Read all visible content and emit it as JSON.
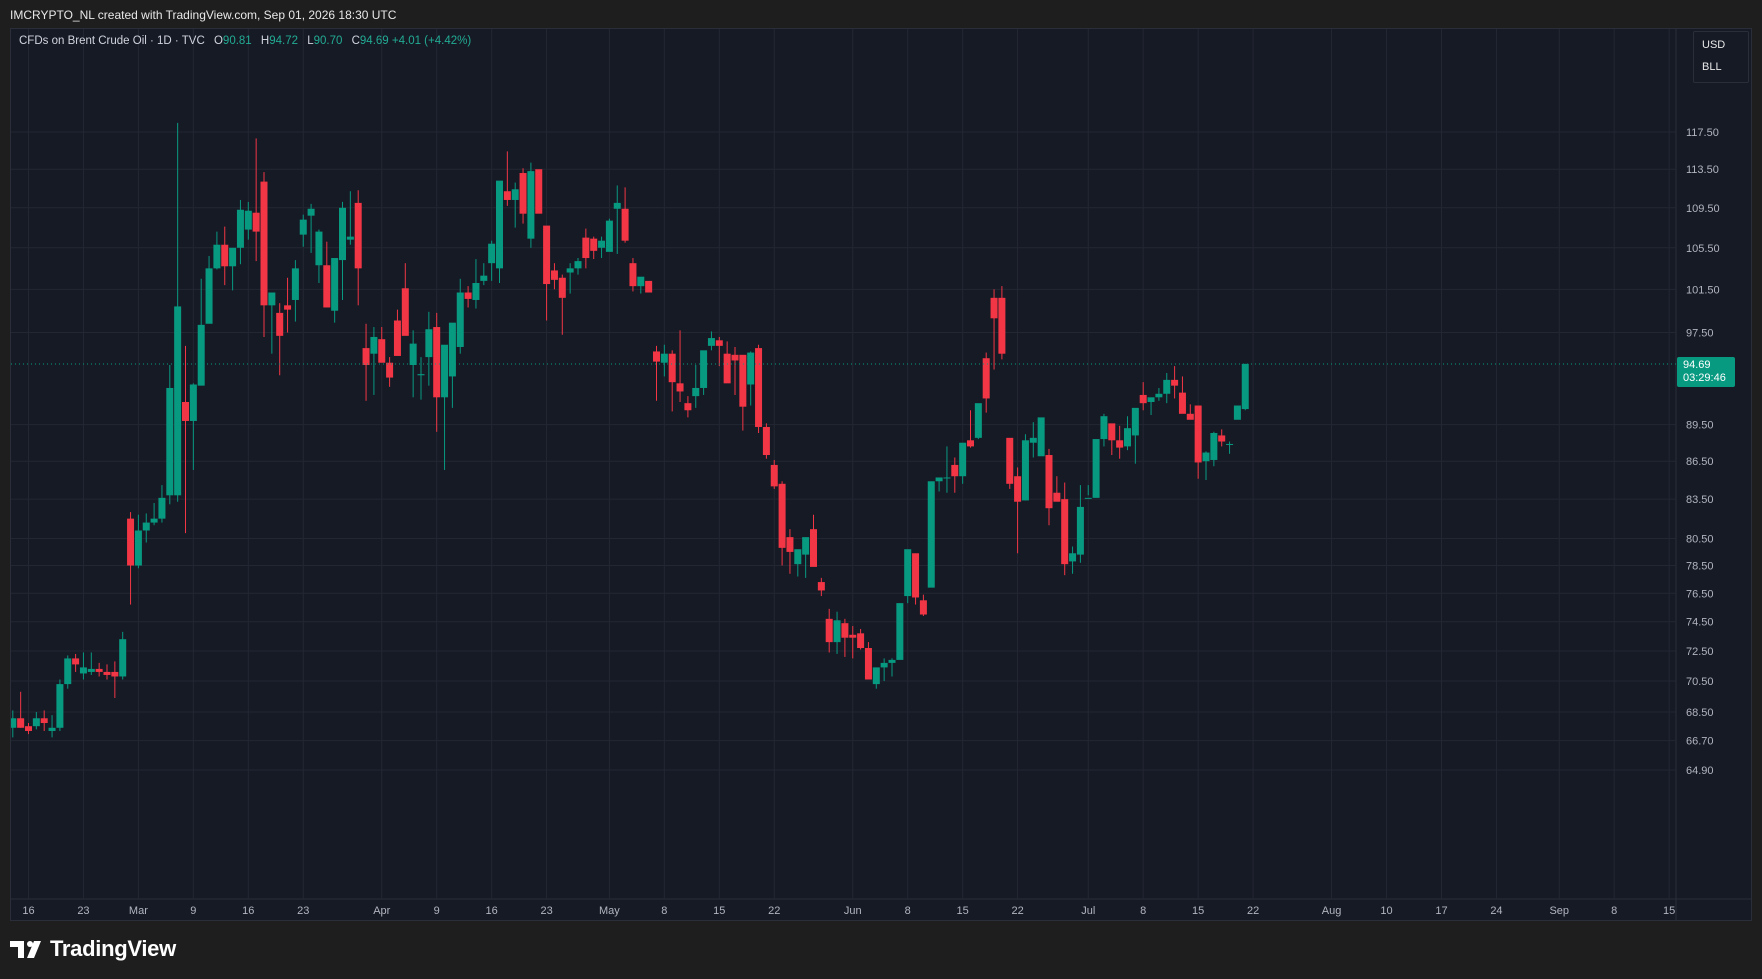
{
  "attribution": "IMCRYPTO_NL created with TradingView.com, Sep 01, 2026 18:30 UTC",
  "legend": {
    "symbol": "CFDs on Brent Crude Oil · 1D · TVC",
    "open_label": "O",
    "open_value": "90.81",
    "high_label": "H",
    "high_value": "94.72",
    "low_label": "L",
    "low_value": "90.70",
    "close_label": "C",
    "close_value": "94.69",
    "change": "+4.01 (+4.42%)"
  },
  "units": {
    "currency": "USD",
    "measure": "BLL"
  },
  "last_price": {
    "price": "94.69",
    "countdown": "03:29:46"
  },
  "brand": {
    "logo_text": "TradingView"
  },
  "colors": {
    "up": "#089981",
    "down": "#f23645",
    "background": "#161a25",
    "grid": "#232733"
  },
  "chart_data": {
    "type": "candlestick",
    "y_axis": {
      "ticks": [
        117.5,
        113.5,
        109.5,
        105.5,
        101.5,
        97.5,
        89.5,
        86.5,
        83.5,
        80.5,
        78.5,
        76.5,
        74.5,
        72.5,
        70.5,
        68.5,
        66.7,
        64.9
      ],
      "tick_labels": [
        "117.50",
        "113.50",
        "109.50",
        "105.50",
        "101.50",
        "97.50",
        "89.50",
        "86.50",
        "83.50",
        "80.50",
        "78.50",
        "76.50",
        "74.50",
        "72.50",
        "70.50",
        "68.50",
        "66.70",
        "64.90"
      ],
      "scale": "log"
    },
    "x_axis": {
      "tick_labels": [
        {
          "label": "16",
          "day": 0
        },
        {
          "label": "23",
          "day": 7
        },
        {
          "label": "Mar",
          "day": 14
        },
        {
          "label": "9",
          "day": 21
        },
        {
          "label": "16",
          "day": 28
        },
        {
          "label": "23",
          "day": 35
        },
        {
          "label": "Apr",
          "day": 45
        },
        {
          "label": "9",
          "day": 52
        },
        {
          "label": "16",
          "day": 59
        },
        {
          "label": "23",
          "day": 66
        },
        {
          "label": "May",
          "day": 74
        },
        {
          "label": "8",
          "day": 81
        },
        {
          "label": "15",
          "day": 88
        },
        {
          "label": "22",
          "day": 95
        },
        {
          "label": "Jun",
          "day": 105
        },
        {
          "label": "8",
          "day": 112
        },
        {
          "label": "15",
          "day": 119
        },
        {
          "label": "22",
          "day": 126
        },
        {
          "label": "Jul",
          "day": 135
        },
        {
          "label": "8",
          "day": 142
        },
        {
          "label": "15",
          "day": 149
        },
        {
          "label": "22",
          "day": 156
        },
        {
          "label": "Aug",
          "day": 166
        },
        {
          "label": "10",
          "day": 173
        },
        {
          "label": "17",
          "day": 180
        },
        {
          "label": "24",
          "day": 187
        },
        {
          "label": "Sep",
          "day": 195
        },
        {
          "label": "8",
          "day": 202
        },
        {
          "label": "15",
          "day": 209
        }
      ]
    },
    "candles": [
      [
        -2,
        67.5,
        68.6,
        66.9,
        68.1
      ],
      [
        -1,
        68.1,
        69.8,
        67.5,
        67.5
      ],
      [
        0,
        67.6,
        67.8,
        67.1,
        67.3
      ],
      [
        1,
        67.6,
        68.5,
        67.4,
        68.1
      ],
      [
        2,
        68.1,
        68.6,
        67.3,
        67.8
      ],
      [
        3,
        67.3,
        68.3,
        66.9,
        67.5
      ],
      [
        4,
        67.5,
        70.6,
        67.3,
        70.3
      ],
      [
        5,
        70.3,
        72.2,
        70.0,
        72.0
      ],
      [
        6,
        72.0,
        72.3,
        71.1,
        71.6
      ],
      [
        7,
        71.0,
        72.4,
        70.6,
        71.4
      ],
      [
        8,
        71.1,
        72.4,
        70.9,
        71.3
      ],
      [
        9,
        71.3,
        71.7,
        70.8,
        71.1
      ],
      [
        10,
        71.1,
        71.6,
        70.6,
        70.9
      ],
      [
        11,
        71.1,
        71.8,
        69.4,
        70.8
      ],
      [
        12,
        70.8,
        73.8,
        70.6,
        73.3
      ],
      [
        13,
        82.0,
        82.5,
        75.7,
        78.5
      ],
      [
        14,
        78.5,
        82.3,
        78.3,
        81.1
      ],
      [
        15,
        81.1,
        82.4,
        80.2,
        81.7
      ],
      [
        16,
        81.7,
        83.2,
        81.5,
        82.0
      ],
      [
        17,
        82.0,
        84.6,
        81.7,
        83.6
      ],
      [
        18,
        83.8,
        94.6,
        83.1,
        92.6
      ],
      [
        19,
        83.8,
        118.5,
        83.3,
        99.9
      ],
      [
        20,
        91.4,
        96.3,
        80.9,
        89.8
      ],
      [
        21,
        89.8,
        93.0,
        85.8,
        92.9
      ],
      [
        22,
        92.8,
        102.5,
        96.1,
        98.2
      ],
      [
        23,
        98.3,
        104.7,
        101.1,
        103.5
      ],
      [
        24,
        103.5,
        107.1,
        103.4,
        105.8
      ],
      [
        25,
        105.8,
        107.6,
        101.9,
        103.7
      ],
      [
        26,
        103.7,
        104.9,
        101.4,
        105.5
      ],
      [
        27,
        105.5,
        110.3,
        103.9,
        109.3
      ],
      [
        28,
        107.3,
        110.1,
        106.3,
        109.2
      ],
      [
        29,
        109.0,
        116.8,
        104.2,
        107.1
      ],
      [
        30,
        112.2,
        113.2,
        97.1,
        100.0
      ],
      [
        31,
        100.0,
        101.0,
        95.6,
        101.2
      ],
      [
        32,
        99.3,
        100.2,
        93.7,
        97.2
      ],
      [
        33,
        100.0,
        102.6,
        97.5,
        99.6
      ],
      [
        34,
        100.5,
        104.3,
        98.5,
        103.5
      ],
      [
        35,
        106.8,
        108.8,
        105.6,
        108.3
      ],
      [
        36,
        108.7,
        109.9,
        105.0,
        109.4
      ],
      [
        37,
        103.8,
        107.3,
        102.1,
        107.1
      ],
      [
        38,
        103.8,
        106.1,
        100.4,
        99.8
      ],
      [
        39,
        99.5,
        103.4,
        98.4,
        104.5
      ],
      [
        40,
        104.3,
        110.1,
        100.5,
        109.5
      ],
      [
        41,
        106.3,
        111.2,
        105.8,
        106.6
      ],
      [
        42,
        110.0,
        111.3,
        100.0,
        103.5
      ],
      [
        43,
        96.1,
        98.3,
        91.5,
        94.6
      ],
      [
        44,
        95.6,
        98.0,
        92.0,
        97.1
      ],
      [
        45,
        96.9,
        98.0,
        96.2,
        94.8
      ],
      [
        46,
        94.8,
        95.3,
        92.7,
        93.5
      ],
      [
        47,
        98.6,
        99.6,
        96.2,
        95.4
      ],
      [
        48,
        101.6,
        104.0,
        98.5,
        97.2
      ],
      [
        49,
        94.6,
        97.7,
        91.8,
        96.5
      ],
      [
        50,
        93.7,
        95.3,
        91.6,
        93.8
      ],
      [
        51,
        95.3,
        99.4,
        92.8,
        97.8
      ],
      [
        52,
        98.0,
        99.3,
        88.9,
        91.8
      ],
      [
        53,
        91.8,
        94.7,
        85.8,
        96.4
      ],
      [
        54,
        93.6,
        98.3,
        90.9,
        98.4
      ],
      [
        55,
        96.2,
        102.5,
        95.6,
        101.2
      ],
      [
        56,
        101.2,
        101.8,
        99.8,
        100.6
      ],
      [
        57,
        100.5,
        104.4,
        99.7,
        102.1
      ],
      [
        58,
        102.3,
        104.0,
        101.9,
        102.8
      ],
      [
        59,
        104.0,
        106.2,
        102.3,
        105.9
      ],
      [
        60,
        103.5,
        110.8,
        102.1,
        112.3
      ],
      [
        61,
        111.2,
        115.4,
        109.7,
        110.3
      ],
      [
        62,
        110.3,
        112.1,
        107.5,
        111.4
      ],
      [
        63,
        113.1,
        113.6,
        107.9,
        108.9
      ],
      [
        64,
        106.4,
        114.2,
        105.5,
        113.3
      ],
      [
        65,
        113.5,
        113.0,
        109.5,
        108.9
      ],
      [
        66,
        107.7,
        107.2,
        98.6,
        102.0
      ],
      [
        67,
        103.3,
        104.0,
        101.5,
        102.4
      ],
      [
        68,
        102.6,
        102.9,
        97.3,
        100.7
      ],
      [
        69,
        103.1,
        104.0,
        101.1,
        103.5
      ],
      [
        70,
        103.5,
        104.5,
        102.9,
        104.2
      ],
      [
        71,
        106.5,
        107.4,
        103.5,
        104.5
      ],
      [
        72,
        106.4,
        106.6,
        104.4,
        105.2
      ],
      [
        73,
        105.5,
        106.6,
        104.5,
        106.2
      ],
      [
        74,
        105.1,
        108.4,
        105.5,
        108.2
      ],
      [
        75,
        109.4,
        111.8,
        104.9,
        110.0
      ],
      [
        76,
        109.4,
        111.6,
        106.0,
        106.2
      ],
      [
        77,
        104.0,
        104.5,
        101.3,
        101.8
      ],
      [
        78,
        101.8,
        102.6,
        101.1,
        102.7
      ],
      [
        79,
        102.3,
        102.2,
        102.1,
        101.2
      ],
      [
        80,
        95.8,
        96.3,
        91.5,
        94.9
      ],
      [
        81,
        94.8,
        96.4,
        93.6,
        95.6
      ],
      [
        82,
        95.6,
        95.9,
        90.6,
        93.1
      ],
      [
        83,
        93.0,
        97.7,
        91.4,
        92.3
      ],
      [
        84,
        91.3,
        91.9,
        90.1,
        90.7
      ],
      [
        85,
        91.9,
        94.6,
        90.9,
        92.6
      ],
      [
        86,
        92.6,
        95.6,
        92.0,
        95.9
      ],
      [
        87,
        96.3,
        97.6,
        95.9,
        97.0
      ],
      [
        88,
        96.8,
        97.1,
        94.5,
        96.3
      ],
      [
        89,
        95.6,
        96.7,
        94.9,
        93.0
      ],
      [
        90,
        95.5,
        96.2,
        92.0,
        95.0
      ],
      [
        91,
        95.5,
        95.4,
        89.0,
        91.0
      ],
      [
        92,
        92.9,
        95.8,
        91.1,
        95.7
      ],
      [
        93,
        96.1,
        96.4,
        88.8,
        89.3
      ],
      [
        94,
        89.3,
        89.6,
        86.7,
        87.0
      ],
      [
        95,
        86.2,
        86.6,
        84.3,
        84.5
      ],
      [
        96,
        84.7,
        84.9,
        78.5,
        79.8
      ],
      [
        97,
        80.6,
        81.2,
        77.9,
        79.5
      ],
      [
        98,
        78.6,
        79.3,
        77.7,
        79.7
      ],
      [
        99,
        79.3,
        80.3,
        77.6,
        80.6
      ],
      [
        100,
        81.2,
        82.3,
        79.9,
        78.4
      ],
      [
        101,
        77.3,
        77.6,
        76.3,
        76.7
      ],
      [
        102,
        74.7,
        75.4,
        72.4,
        73.1
      ],
      [
        103,
        73.1,
        75.2,
        72.3,
        74.6
      ],
      [
        104,
        74.4,
        74.7,
        72.1,
        73.4
      ],
      [
        105,
        73.6,
        74.2,
        72.0,
        73.4
      ],
      [
        106,
        73.7,
        74.0,
        72.6,
        72.7
      ],
      [
        107,
        72.7,
        73.1,
        70.8,
        70.6
      ],
      [
        108,
        70.3,
        71.4,
        70.0,
        71.4
      ],
      [
        109,
        71.4,
        72.0,
        70.5,
        71.7
      ],
      [
        110,
        71.7,
        72.0,
        70.8,
        71.9
      ],
      [
        111,
        71.9,
        75.8,
        72.1,
        75.8
      ],
      [
        112,
        76.3,
        79.2,
        75.8,
        79.7
      ],
      [
        113,
        79.4,
        79.3,
        75.7,
        76.2
      ],
      [
        114,
        76.0,
        76.4,
        74.9,
        75.0
      ],
      [
        115,
        76.9,
        79.4,
        77.2,
        84.9
      ],
      [
        116,
        84.9,
        85.2,
        84.1,
        85.2
      ],
      [
        117,
        85.2,
        87.7,
        84.0,
        85.2
      ],
      [
        118,
        86.2,
        86.8,
        84.0,
        85.3
      ],
      [
        119,
        85.3,
        87.7,
        84.7,
        88.0
      ],
      [
        120,
        88.2,
        90.7,
        87.6,
        87.7
      ],
      [
        121,
        88.4,
        90.3,
        88.3,
        91.3
      ],
      [
        122,
        95.2,
        95.7,
        90.5,
        91.7
      ],
      [
        123,
        100.7,
        101.5,
        94.2,
        98.8
      ],
      [
        124,
        100.7,
        101.8,
        95.1,
        95.6
      ],
      [
        125,
        88.4,
        88.0,
        84.3,
        84.7
      ],
      [
        126,
        85.3,
        86.0,
        79.4,
        83.3
      ],
      [
        127,
        83.4,
        88.7,
        83.4,
        88.2
      ],
      [
        128,
        88.0,
        89.7,
        86.8,
        88.4
      ],
      [
        129,
        86.9,
        89.9,
        87.3,
        90.1
      ],
      [
        130,
        87.0,
        87.5,
        81.5,
        82.8
      ],
      [
        131,
        84.0,
        85.3,
        83.8,
        83.3
      ],
      [
        132,
        83.5,
        84.8,
        77.8,
        78.6
      ],
      [
        133,
        78.8,
        79.9,
        77.9,
        79.4
      ],
      [
        134,
        79.3,
        84.6,
        78.7,
        82.9
      ],
      [
        135,
        83.6,
        84.6,
        83.8,
        83.6
      ],
      [
        136,
        83.6,
        85.1,
        83.8,
        88.3
      ],
      [
        137,
        88.3,
        90.4,
        87.7,
        90.2
      ],
      [
        138,
        89.6,
        89.4,
        87.0,
        88.2
      ],
      [
        139,
        88.2,
        89.4,
        86.7,
        87.6
      ],
      [
        140,
        87.7,
        90.2,
        87.4,
        89.2
      ],
      [
        141,
        88.6,
        88.8,
        86.3,
        90.9
      ],
      [
        142,
        92.0,
        93.1,
        90.7,
        91.3
      ],
      [
        143,
        91.4,
        91.6,
        90.3,
        91.8
      ],
      [
        144,
        91.8,
        92.6,
        91.5,
        92.1
      ],
      [
        145,
        92.1,
        93.9,
        91.3,
        93.3
      ],
      [
        146,
        93.3,
        94.5,
        91.7,
        92.8
      ],
      [
        147,
        92.2,
        93.6,
        90.9,
        90.4
      ],
      [
        148,
        90.4,
        91.2,
        90.0,
        89.9
      ],
      [
        149,
        91.1,
        90.8,
        85.1,
        86.4
      ],
      [
        150,
        86.5,
        87.3,
        85.0,
        87.2
      ],
      [
        151,
        86.6,
        88.9,
        86.1,
        88.8
      ],
      [
        152,
        88.6,
        89.1,
        87.7,
        88.1
      ],
      [
        153,
        87.9,
        88.1,
        87.1,
        87.9
      ],
      [
        154,
        89.9,
        90.6,
        90.0,
        91.1
      ],
      [
        155,
        90.8,
        94.7,
        90.7,
        94.7
      ]
    ]
  }
}
